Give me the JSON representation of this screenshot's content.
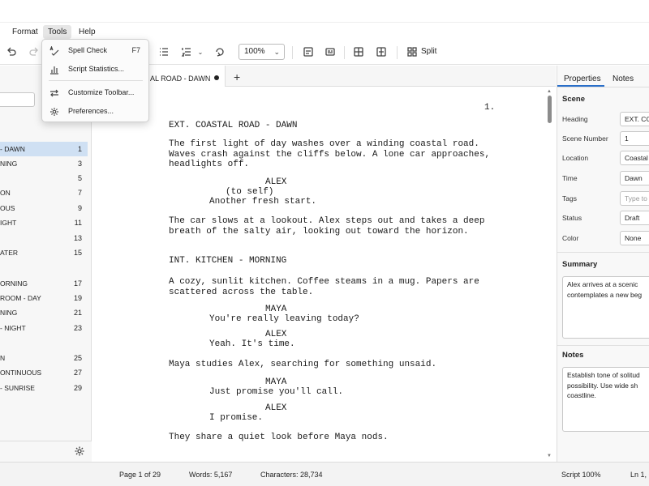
{
  "menu": {
    "items": [
      "Format",
      "Tools",
      "Help"
    ],
    "active": "Tools"
  },
  "tools_menu": {
    "items": [
      {
        "label": "Spell Check",
        "shortcut": "F7",
        "icon": "spell-check-icon"
      },
      {
        "label": "Script Statistics...",
        "shortcut": "",
        "icon": "bar-chart-icon"
      },
      {
        "label": "Customize Toolbar...",
        "shortcut": "",
        "icon": "swap-arrows-icon"
      },
      {
        "label": "Preferences...",
        "shortcut": "",
        "icon": "gear-icon"
      }
    ]
  },
  "toolbar": {
    "zoom": "100%",
    "split_label": "Split"
  },
  "tab": {
    "label": "AL ROAD - DAWN"
  },
  "scenes": [
    {
      "name": "- DAWN",
      "num": "1",
      "selected": true
    },
    {
      "name": "NING",
      "num": "3"
    },
    {
      "name": "",
      "num": "5"
    },
    {
      "name": "ON",
      "num": "7"
    },
    {
      "name": "OUS",
      "num": "9"
    },
    {
      "name": "IGHT",
      "num": "11"
    },
    {
      "name": "",
      "num": "13"
    },
    {
      "name": "ATER",
      "num": "15"
    },
    {
      "name": "ORNING",
      "num": "17"
    },
    {
      "name": "ROOM - DAY",
      "num": "19"
    },
    {
      "name": "NING",
      "num": "21"
    },
    {
      "name": "- NIGHT",
      "num": "23"
    },
    {
      "name": "N",
      "num": "25"
    },
    {
      "name": "ONTINUOUS",
      "num": "27"
    },
    {
      "name": "- SUNRISE",
      "num": "29"
    }
  ],
  "script": {
    "page_number": "1.",
    "lines": [
      {
        "text": "EXT. COASTAL ROAD - DAWN",
        "indent": 0
      },
      {
        "text": "The first light of day washes over a winding coastal road.\nWaves crash against the cliffs below. A lone car approaches,\nheadlights off.",
        "indent": 0
      },
      {
        "text": "ALEX",
        "indent": 2
      },
      {
        "text": "(to self)",
        "indent": 1
      },
      {
        "text": "Another fresh start.",
        "indent": 1
      },
      {
        "text": "The car slows at a lookout. Alex steps out and takes a deep\nbreath of the salty air, looking out toward the horizon.",
        "indent": 0
      },
      {
        "text": "INT. KITCHEN - MORNING",
        "indent": 0
      },
      {
        "text": "A cozy, sunlit kitchen. Coffee steams in a mug. Papers are\nscattered across the table.",
        "indent": 0
      },
      {
        "text": "MAYA",
        "indent": 2
      },
      {
        "text": "You're really leaving today?",
        "indent": 1
      },
      {
        "text": "ALEX",
        "indent": 2
      },
      {
        "text": "Yeah. It's time.",
        "indent": 1
      },
      {
        "text": "Maya studies Alex, searching for something unsaid.",
        "indent": 0
      },
      {
        "text": "MAYA",
        "indent": 2
      },
      {
        "text": "Just promise you'll call.",
        "indent": 1
      },
      {
        "text": "ALEX",
        "indent": 2
      },
      {
        "text": "I promise.",
        "indent": 1
      },
      {
        "text": "They share a quiet look before Maya nods.",
        "indent": 0
      }
    ]
  },
  "properties": {
    "tabs": [
      "Properties",
      "Notes"
    ],
    "active_tab": "Properties",
    "scene_section": "Scene",
    "fields": [
      {
        "label": "Heading",
        "value": "EXT. COA"
      },
      {
        "label": "Scene Number",
        "value": "1"
      },
      {
        "label": "Location",
        "value": "Coastal"
      },
      {
        "label": "Time",
        "value": "Dawn"
      },
      {
        "label": "Tags",
        "value": "",
        "placeholder": "Type to"
      },
      {
        "label": "Status",
        "value": "Draft"
      },
      {
        "label": "Color",
        "value": "None"
      }
    ],
    "summary_label": "Summary",
    "summary_text": "Alex arrives at a scenic\ncontemplates a new beg",
    "notes_label": "Notes",
    "notes_text": "Establish tone of solitud\npossibility. Use wide sh\ncoastline."
  },
  "status": {
    "page": "Page 1 of 29",
    "words": "Words:  5,167",
    "characters": "Characters:  28,734",
    "script_zoom": "Script  100%",
    "position": "Ln 1, C"
  }
}
